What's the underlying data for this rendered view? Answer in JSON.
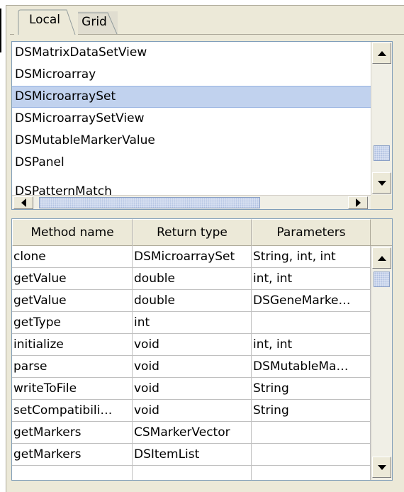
{
  "tabs": [
    {
      "label": "Local",
      "active": true
    },
    {
      "label": "Grid",
      "active": false
    }
  ],
  "class_list": {
    "items": [
      "DSMatrixDataSetView",
      "DSMicroarray",
      "DSMicroarraySet",
      "DSMicroarraySetView",
      "DSMutableMarkerValue",
      "DSPanel",
      "DSPatternMatch"
    ],
    "selected": "DSMicroarraySet"
  },
  "methods_table": {
    "columns": [
      "Method name",
      "Return type",
      "Parameters"
    ],
    "rows": [
      [
        "clone",
        "DSMicroarraySet",
        "String, int, int"
      ],
      [
        "getValue",
        "double",
        "int, int"
      ],
      [
        "getValue",
        "double",
        "DSGeneMarke…"
      ],
      [
        "getType",
        "int",
        ""
      ],
      [
        "initialize",
        "void",
        "int, int"
      ],
      [
        "parse",
        "void",
        "DSMutableMa…"
      ],
      [
        "writeToFile",
        "void",
        "String"
      ],
      [
        "setCompatibili…",
        "void",
        "String"
      ],
      [
        "getMarkers",
        "CSMarkerVector",
        ""
      ],
      [
        "getMarkers",
        "DSItemList",
        ""
      ],
      [
        "",
        "",
        ""
      ]
    ]
  },
  "colors": {
    "selection": "#c1d2ee",
    "panel": "#ece9d8",
    "border": "#7f9db9"
  }
}
